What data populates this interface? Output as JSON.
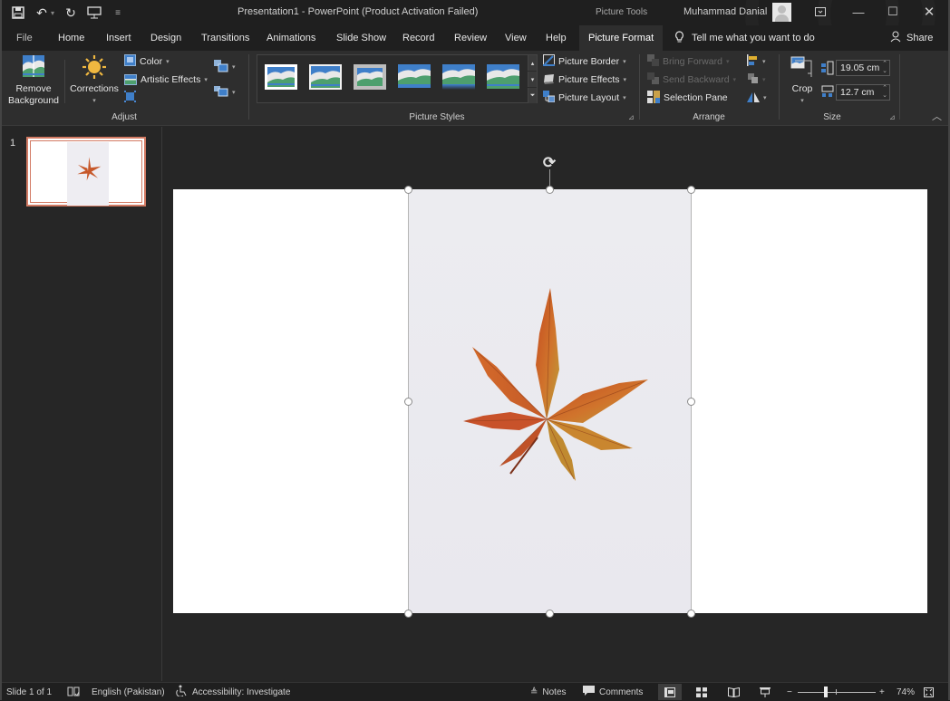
{
  "titlebar": {
    "document_title": "Presentation1  -  PowerPoint (Product Activation Failed)",
    "context_title": "Picture Tools",
    "user_name": "Muhammad Danial",
    "qat": [
      "save-icon",
      "undo-icon",
      "redo-icon",
      "present-from-start-icon",
      "customize-qat-icon"
    ]
  },
  "tabs": {
    "items": [
      "File",
      "Home",
      "Insert",
      "Design",
      "Transitions",
      "Animations",
      "Slide Show",
      "Record",
      "Review",
      "View",
      "Help",
      "Picture Format"
    ],
    "active": "Picture Format",
    "tell_me": "Tell me what you want to do",
    "share": "Share"
  },
  "ribbon": {
    "adjust": {
      "label": "Adjust",
      "remove_background_1": "Remove",
      "remove_background_2": "Background",
      "corrections": "Corrections",
      "color": "Color",
      "artistic_effects": "Artistic Effects"
    },
    "picture_styles": {
      "label": "Picture Styles",
      "picture_border": "Picture Border",
      "picture_effects": "Picture Effects",
      "picture_layout": "Picture Layout",
      "style_count": 6
    },
    "arrange": {
      "label": "Arrange",
      "bring_forward": "Bring Forward",
      "send_backward": "Send Backward",
      "selection_pane": "Selection Pane"
    },
    "size": {
      "label": "Size",
      "crop": "Crop",
      "height": "19.05 cm",
      "width": "12.7 cm"
    }
  },
  "thumbnails": {
    "slides": [
      {
        "number": "1",
        "selected": true
      }
    ]
  },
  "slide": {
    "selected_object": "picture-maple-leaf"
  },
  "statusbar": {
    "slide_info": "Slide 1 of 1",
    "language": "English (Pakistan)",
    "accessibility": "Accessibility: Investigate",
    "notes": "Notes",
    "comments": "Comments",
    "zoom_minus": "−",
    "zoom_plus": "+",
    "zoom_level": "74%",
    "active_view": "normal"
  },
  "colors": {
    "thumbnail_selection": "#d27a63",
    "ribbon_bg": "#2e2e2e",
    "title_bg": "#1f1f1f"
  }
}
